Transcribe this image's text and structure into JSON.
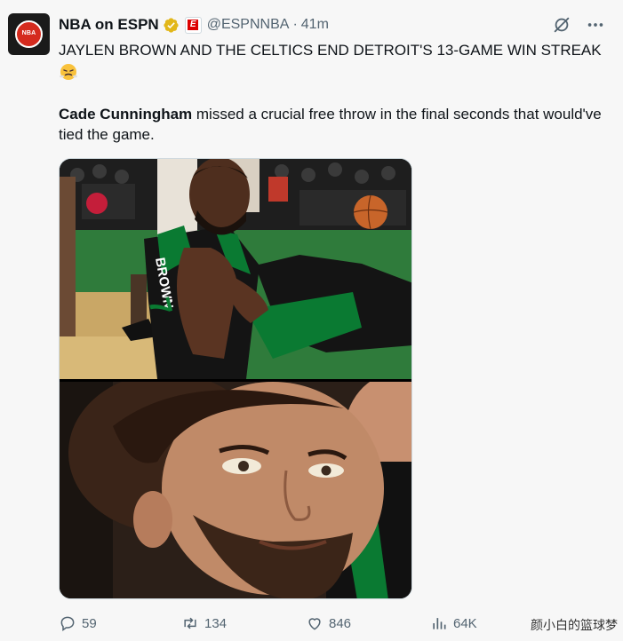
{
  "account": {
    "avatar_text": "NBA",
    "display_name": "NBA on ESPN",
    "affiliate_badge": "E",
    "handle": "@ESPNNBA",
    "separator": "·",
    "time": "41m"
  },
  "tweet": {
    "headline": "JAYLEN BROWN AND THE CELTICS END DETROIT'S 13-GAME WIN STREAK",
    "emoji": "face-with-steam-icon",
    "body_bold": "Cade Cunningham",
    "body_rest": " missed a crucial free throw in the final seconds that would've tied the game."
  },
  "media": {
    "photo_1": "jaylen-brown-photo",
    "photo_2": "cade-cunningham-photo",
    "jersey_name": "BROWN"
  },
  "actions": {
    "replies": "59",
    "reposts": "134",
    "likes": "846",
    "views": "64K"
  },
  "watermark": "颜小白的篮球梦",
  "colors": {
    "text": "#0f1419",
    "secondary": "#536471",
    "verified_gold": "#e2b719",
    "celtics_green": "#0a7a32"
  }
}
